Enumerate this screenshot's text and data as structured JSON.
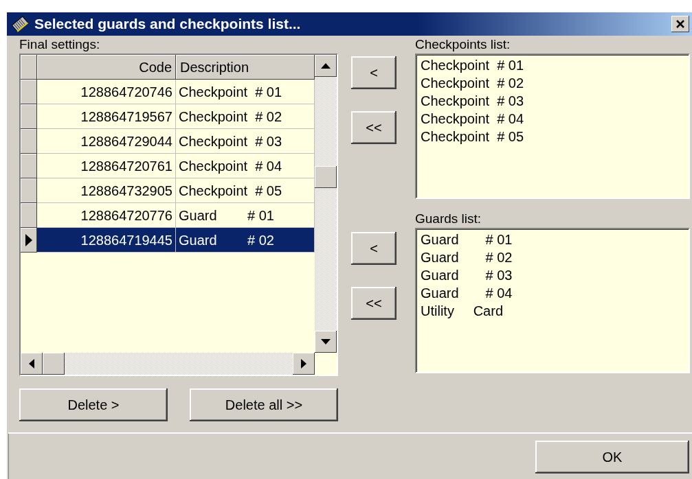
{
  "window": {
    "title": "Selected guards and checkpoints list..."
  },
  "final_settings": {
    "label": "Final settings:",
    "columns": [
      "Code",
      "Description"
    ],
    "rows": [
      {
        "code": "128864720746",
        "description": "Checkpoint  # 01",
        "selected": false
      },
      {
        "code": "128864719567",
        "description": "Checkpoint  # 02",
        "selected": false
      },
      {
        "code": "128864729044",
        "description": "Checkpoint  # 03",
        "selected": false
      },
      {
        "code": "128864720761",
        "description": "Checkpoint  # 04",
        "selected": false
      },
      {
        "code": "128864732905",
        "description": "Checkpoint  # 05",
        "selected": false
      },
      {
        "code": "128864720776",
        "description": "Guard        # 01",
        "selected": false
      },
      {
        "code": "128864719445",
        "description": "Guard        # 02",
        "selected": true
      }
    ]
  },
  "checkpoint_buttons": [
    "<",
    "<<"
  ],
  "guard_buttons": [
    "<",
    "<<"
  ],
  "checkpoints_list": {
    "label": "Checkpoints list:",
    "items": [
      "Checkpoint  # 01",
      "Checkpoint  # 02",
      "Checkpoint  # 03",
      "Checkpoint  # 04",
      "Checkpoint  # 05"
    ]
  },
  "guards_list": {
    "label": "Guards list:",
    "items": [
      "Guard       # 01",
      "Guard       # 02",
      "Guard       # 03",
      "Guard       # 04",
      "Utility     Card"
    ]
  },
  "delete_buttons": [
    "Delete >",
    "Delete all >>"
  ],
  "ok_button": "OK"
}
